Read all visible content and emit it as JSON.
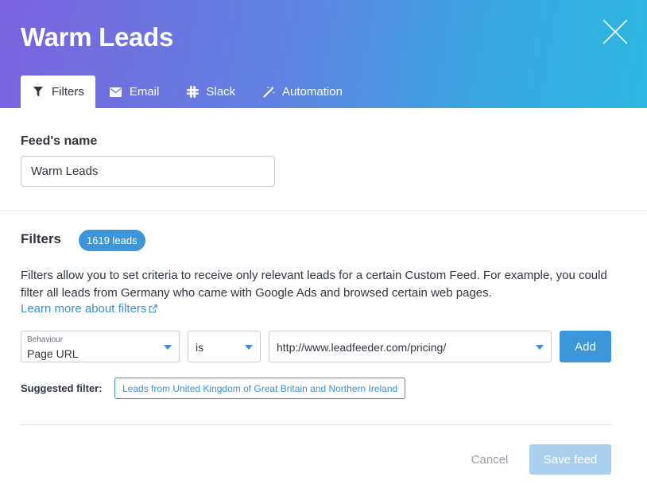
{
  "modal": {
    "title": "Warm Leads",
    "close_icon": "close-icon"
  },
  "tabs": [
    {
      "label": "Filters",
      "icon": "filter-icon",
      "active": true
    },
    {
      "label": "Email",
      "icon": "email-icon",
      "active": false
    },
    {
      "label": "Slack",
      "icon": "slack-icon",
      "active": false
    },
    {
      "label": "Automation",
      "icon": "magic-wand-icon",
      "active": false
    }
  ],
  "feed_name": {
    "label": "Feed's name",
    "value": "Warm Leads"
  },
  "filters": {
    "title": "Filters",
    "leads_badge": "1619 leads",
    "description": "Filters allow you to set criteria to receive only relevant leads for a certain Custom Feed. For example, you could filter all leads from Germany who came with Google Ads and browsed certain web pages.",
    "learn_more": "Learn more about filters",
    "behaviour_label": "Behaviour",
    "behaviour_value": "Page URL",
    "operator_value": "is",
    "url_value": "http://www.leadfeeder.com/pricing/",
    "add_label": "Add",
    "suggested_label": "Suggested filter:",
    "suggested_value": "Leads from United Kingdom of Great Britain and Northern Ireland"
  },
  "footer": {
    "cancel_label": "Cancel",
    "save_label": "Save feed"
  },
  "colors": {
    "accent": "#3c97da",
    "header_gradient_start": "#7b63de",
    "header_gradient_end": "#2bb6df",
    "save_disabled": "#a9d1ef"
  }
}
